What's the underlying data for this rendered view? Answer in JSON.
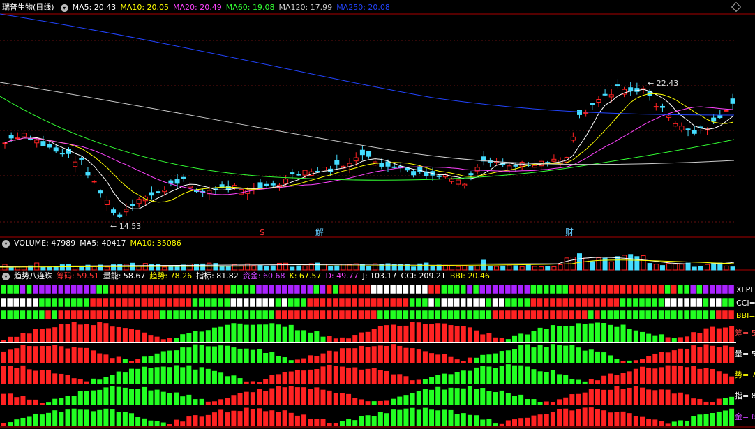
{
  "stock_title": "瑞普生物(日线)",
  "ma_legend": [
    {
      "label": "MA5: 20.43",
      "color": "#ffffff"
    },
    {
      "label": "MA10: 20.05",
      "color": "#ffff00"
    },
    {
      "label": "MA20: 20.49",
      "color": "#ff44ff"
    },
    {
      "label": "MA60: 19.08",
      "color": "#33ff33"
    },
    {
      "label": "MA120: 17.99",
      "color": "#cccccc"
    },
    {
      "label": "MA250: 20.08",
      "color": "#2244ff"
    }
  ],
  "high_label": "22.43",
  "low_label": "14.53",
  "event_markers": [
    {
      "label": "$",
      "color": "#ff3333"
    },
    {
      "label": "解",
      "color": "#66ccff"
    },
    {
      "label": "财",
      "color": "#66ccff"
    }
  ],
  "volume_legend": [
    {
      "label": "VOLUME: 47989",
      "color": "#ffffff"
    },
    {
      "label": "MA5: 40417",
      "color": "#ffffff"
    },
    {
      "label": "MA10: 35086",
      "color": "#ffff00"
    }
  ],
  "indicator_title": "趋势八连珠",
  "indicator_legend": [
    {
      "label": "筹码: 59.51",
      "color": "#ff3333"
    },
    {
      "label": "量能: 58.67",
      "color": "#ffffff"
    },
    {
      "label": "趋势: 78.26",
      "color": "#ffff00"
    },
    {
      "label": "指标: 81.82",
      "color": "#ffffff"
    },
    {
      "label": "资金: 60.68",
      "color": "#cc44ff"
    },
    {
      "label": "K: 67.57",
      "color": "#ffff00"
    },
    {
      "label": "D: 49.77",
      "color": "#ff44ff"
    },
    {
      "label": "J: 103.17",
      "color": "#ffffff"
    },
    {
      "label": "CCI: 209.21",
      "color": "#ffffff"
    },
    {
      "label": "BBI: 20.46",
      "color": "#ffff00"
    }
  ],
  "band_labels": [
    "XLPL",
    "CCI=",
    "BBI="
  ],
  "bar_row_labels": [
    "筹= 5",
    "量= 5",
    "势= 7",
    "指= 8",
    "金= 6"
  ],
  "colors": {
    "up": "#ff2222",
    "down": "#44ddff",
    "bull": "#22ff22",
    "bear": "#ff2222",
    "purple": "#aa22ff",
    "white": "#ffffff"
  }
}
